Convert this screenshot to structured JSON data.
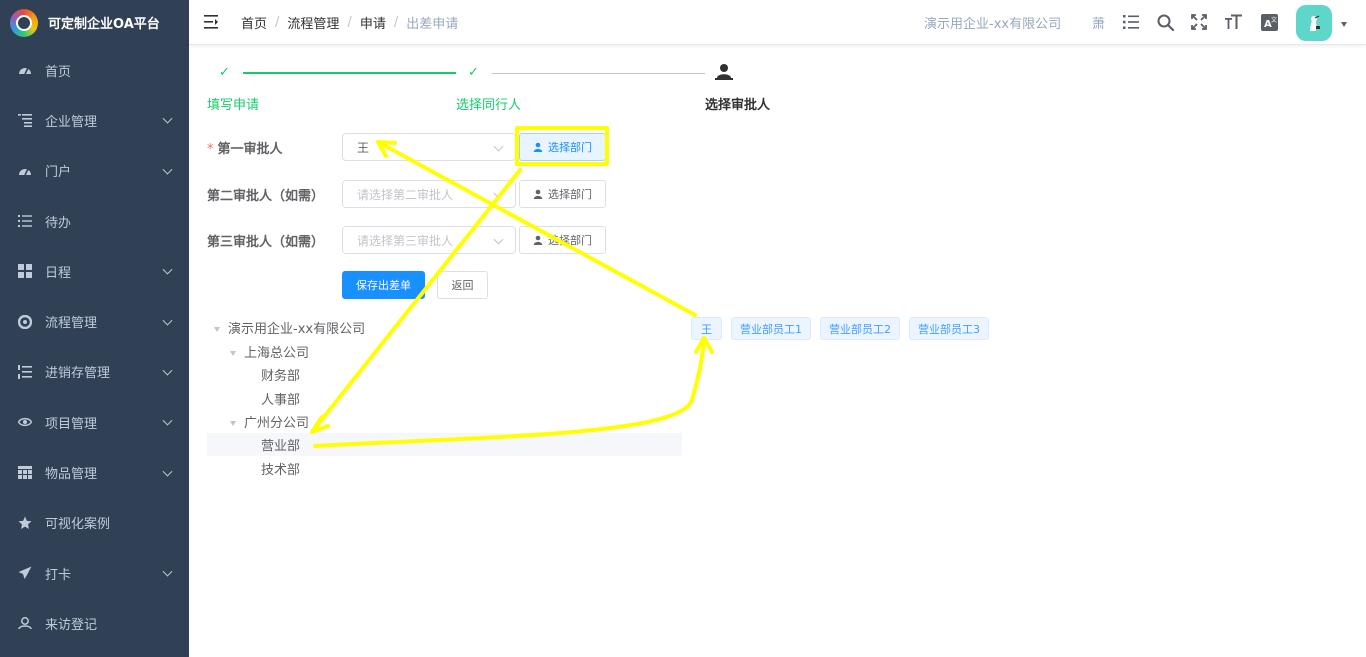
{
  "app": {
    "title": "可定制企业OA平台"
  },
  "sidebar": {
    "items": [
      {
        "label": "首页",
        "icon": "dashboard-icon",
        "has_children": false
      },
      {
        "label": "企业管理",
        "icon": "tree-table-icon",
        "has_children": true
      },
      {
        "label": "门户",
        "icon": "dashboard-icon",
        "has_children": true
      },
      {
        "label": "待办",
        "icon": "list-icon",
        "has_children": false
      },
      {
        "label": "日程",
        "icon": "grid-icon",
        "has_children": true
      },
      {
        "label": "流程管理",
        "icon": "component-icon",
        "has_children": true
      },
      {
        "label": "进销存管理",
        "icon": "ordered-list-icon",
        "has_children": true
      },
      {
        "label": "项目管理",
        "icon": "eye-icon",
        "has_children": true
      },
      {
        "label": "物品管理",
        "icon": "table-icon",
        "has_children": true
      },
      {
        "label": "可视化案例",
        "icon": "star-icon",
        "has_children": false
      },
      {
        "label": "打卡",
        "icon": "paper-plane-icon",
        "has_children": true
      },
      {
        "label": "来访登记",
        "icon": "visitor-icon",
        "has_children": false
      }
    ]
  },
  "navbar": {
    "breadcrumb": [
      "首页",
      "流程管理",
      "申请",
      "出差申请"
    ],
    "company": "演示用企业-xx有限公司",
    "username": "萧",
    "icons": [
      "menu-search-list-icon",
      "search-icon",
      "fullscreen-icon",
      "font-size-icon",
      "translate-icon"
    ]
  },
  "steps": [
    {
      "title": "填写申请",
      "status": "finish"
    },
    {
      "title": "选择同行人",
      "status": "finish"
    },
    {
      "title": "选择审批人",
      "status": "process"
    }
  ],
  "form": {
    "approver1": {
      "label": "第一审批人",
      "required": true,
      "value": "王",
      "placeholder": "",
      "button": "选择部门"
    },
    "approver2": {
      "label": "第二审批人（如需）",
      "required": false,
      "value": "",
      "placeholder": "请选择第二审批人",
      "button": "选择部门"
    },
    "approver3": {
      "label": "第三审批人（如需）",
      "required": false,
      "value": "",
      "placeholder": "请选择第三审批人",
      "button": "选择部门"
    },
    "save_label": "保存出差单",
    "back_label": "返回"
  },
  "tree": {
    "root": "演示用企业-xx有限公司",
    "branch1": "上海总公司",
    "branch1_children": [
      "财务部",
      "人事部"
    ],
    "branch2": "广州分公司",
    "branch2_children": [
      "营业部",
      "技术部"
    ],
    "selected": "营业部"
  },
  "employees": [
    "王",
    "营业部员工1",
    "营业部员工2",
    "营业部员工3"
  ],
  "colors": {
    "sidebar_bg": "#304156",
    "primary": "#1890ff",
    "success": "#13ce66",
    "annotation": "#ffff00"
  }
}
